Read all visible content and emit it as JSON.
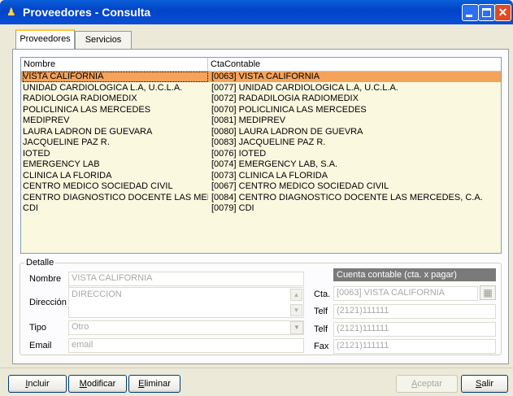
{
  "window": {
    "title": "Proveedores - Consulta",
    "app_icon": "person-icon"
  },
  "tabs": [
    {
      "label": "Proveedores"
    },
    {
      "label": "Servicios"
    }
  ],
  "list": {
    "columns": [
      "Nombre",
      "CtaContable"
    ],
    "rows": [
      [
        "VISTA CALIFORNIA",
        "[0063] VISTA CALIFORNIA"
      ],
      [
        "UNIDAD CARDIOLOGICA L.A, U.C.L.A.",
        "[0077] UNIDAD CARDIOLOGICA L.A, U.C.L.A."
      ],
      [
        "RADIOLOGIA RADIOMEDIX",
        "[0072] RADADILOGIA RADIOMEDIX"
      ],
      [
        "POLICLINICA LAS MERCEDES",
        "[0070] POLICLINICA  LAS MERCEDES"
      ],
      [
        "MEDIPREV",
        "[0081] MEDIPREV"
      ],
      [
        "LAURA LADRON DE GUEVARA",
        "[0080] LAURA LADRON DE GUEVRA"
      ],
      [
        "JACQUELINE PAZ R.",
        "[0083] JACQUELINE PAZ  R."
      ],
      [
        "IOTED",
        "[0076] IOTED"
      ],
      [
        "EMERGENCY LAB",
        "[0074] EMERGENCY LAB, S.A."
      ],
      [
        "CLINICA LA FLORIDA",
        "[0073] CLINICA LA FLORIDA"
      ],
      [
        "CENTRO MEDICO SOCIEDAD CIVIL",
        "[0067] CENTRO MEDICO SOCIEDAD CIVIL"
      ],
      [
        "CENTRO DIAGNOSTICO DOCENTE LAS MER",
        "[0084] CENTRO DIAGNOSTICO DOCENTE LAS MERCEDES, C.A."
      ],
      [
        "CDI",
        "[0079] CDI"
      ]
    ],
    "selected_index": 0,
    "selected_color": "#f5a35a"
  },
  "detalle": {
    "legend": "Detalle",
    "nombre_label": "Nombre",
    "nombre_value": "VISTA CALIFORNIA",
    "direccion_label": "Dirección",
    "direccion_value": "DIRECCION",
    "tipo_label": "Tipo",
    "tipo_value": "Otro",
    "email_label": "Email",
    "email_value": "email",
    "cuenta_header": "Cuenta contable (cta. x pagar)",
    "cta_label": "Cta.",
    "cta_value": "[0063] VISTA CALIFORNIA",
    "telf1_label": "Telf",
    "telf1_value": "(2121)111111",
    "telf2_label": "Telf",
    "telf2_value": "(2121)111111",
    "fax_label": "Fax",
    "fax_value": "(2121)111111"
  },
  "buttons": {
    "incluir": {
      "underline": "I",
      "rest": "ncluir"
    },
    "modificar": {
      "underline": "M",
      "rest": "odificar"
    },
    "eliminar": {
      "underline": "E",
      "rest": "liminar"
    },
    "aceptar": {
      "underline": "A",
      "rest": "ceptar"
    },
    "salir": {
      "underline": "S",
      "rest": "alir"
    }
  }
}
